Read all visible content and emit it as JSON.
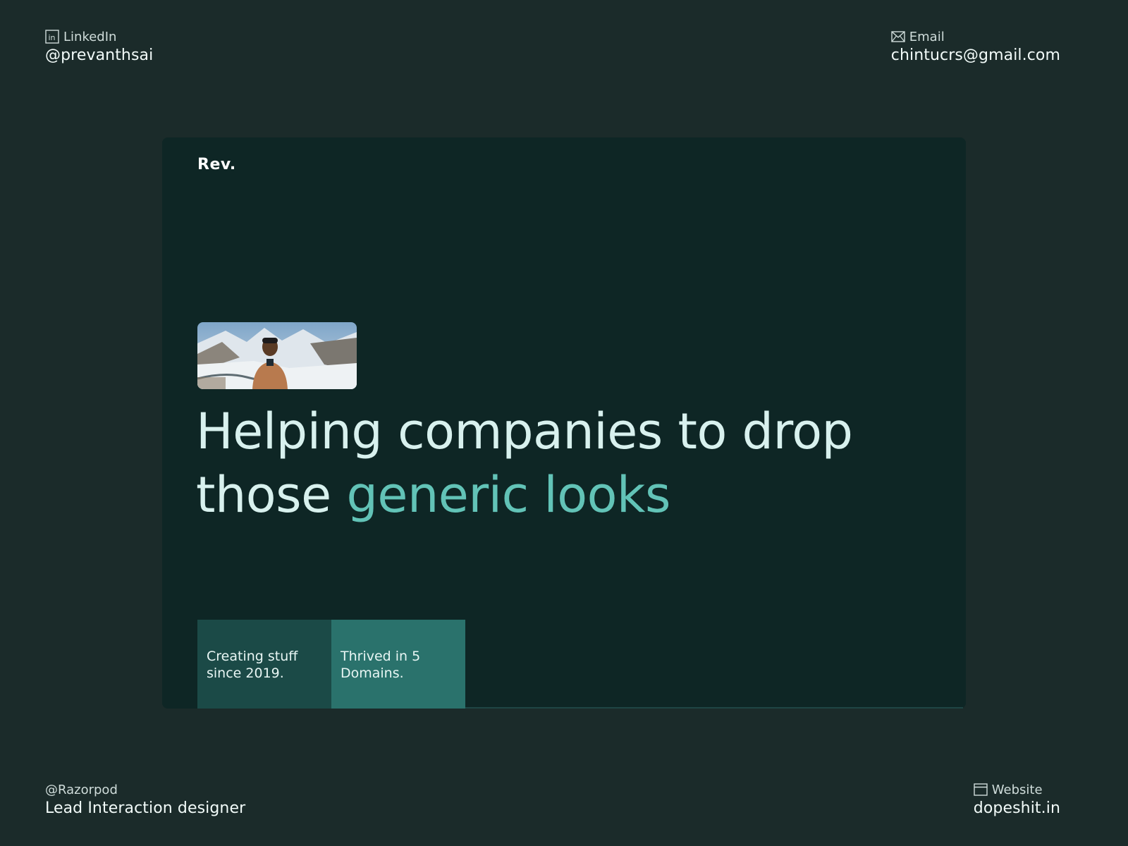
{
  "contacts": {
    "linkedin": {
      "label": "LinkedIn",
      "value": "@prevanthsai",
      "icon": "linkedin-icon"
    },
    "email": {
      "label": "Email",
      "value": "chintucrs@gmail.com",
      "icon": "mail-icon"
    },
    "company": {
      "label": "@Razorpod",
      "value": "Lead Interaction designer"
    },
    "website": {
      "label": "Website",
      "value": "dopeshit.in",
      "icon": "browser-window-icon"
    }
  },
  "card": {
    "brand": "Rev.",
    "headline_part1": "Helping companies to drop those ",
    "headline_accent": "generic looks",
    "stats": [
      {
        "text": "Creating stuff since 2019."
      },
      {
        "text": "Thrived in 5 Domains."
      }
    ]
  },
  "colors": {
    "background": "#1b2b2a",
    "card": "#0e2625",
    "accent": "#62c3b7",
    "stat_dark": "#1b4a47",
    "stat_light": "#2a726c"
  }
}
